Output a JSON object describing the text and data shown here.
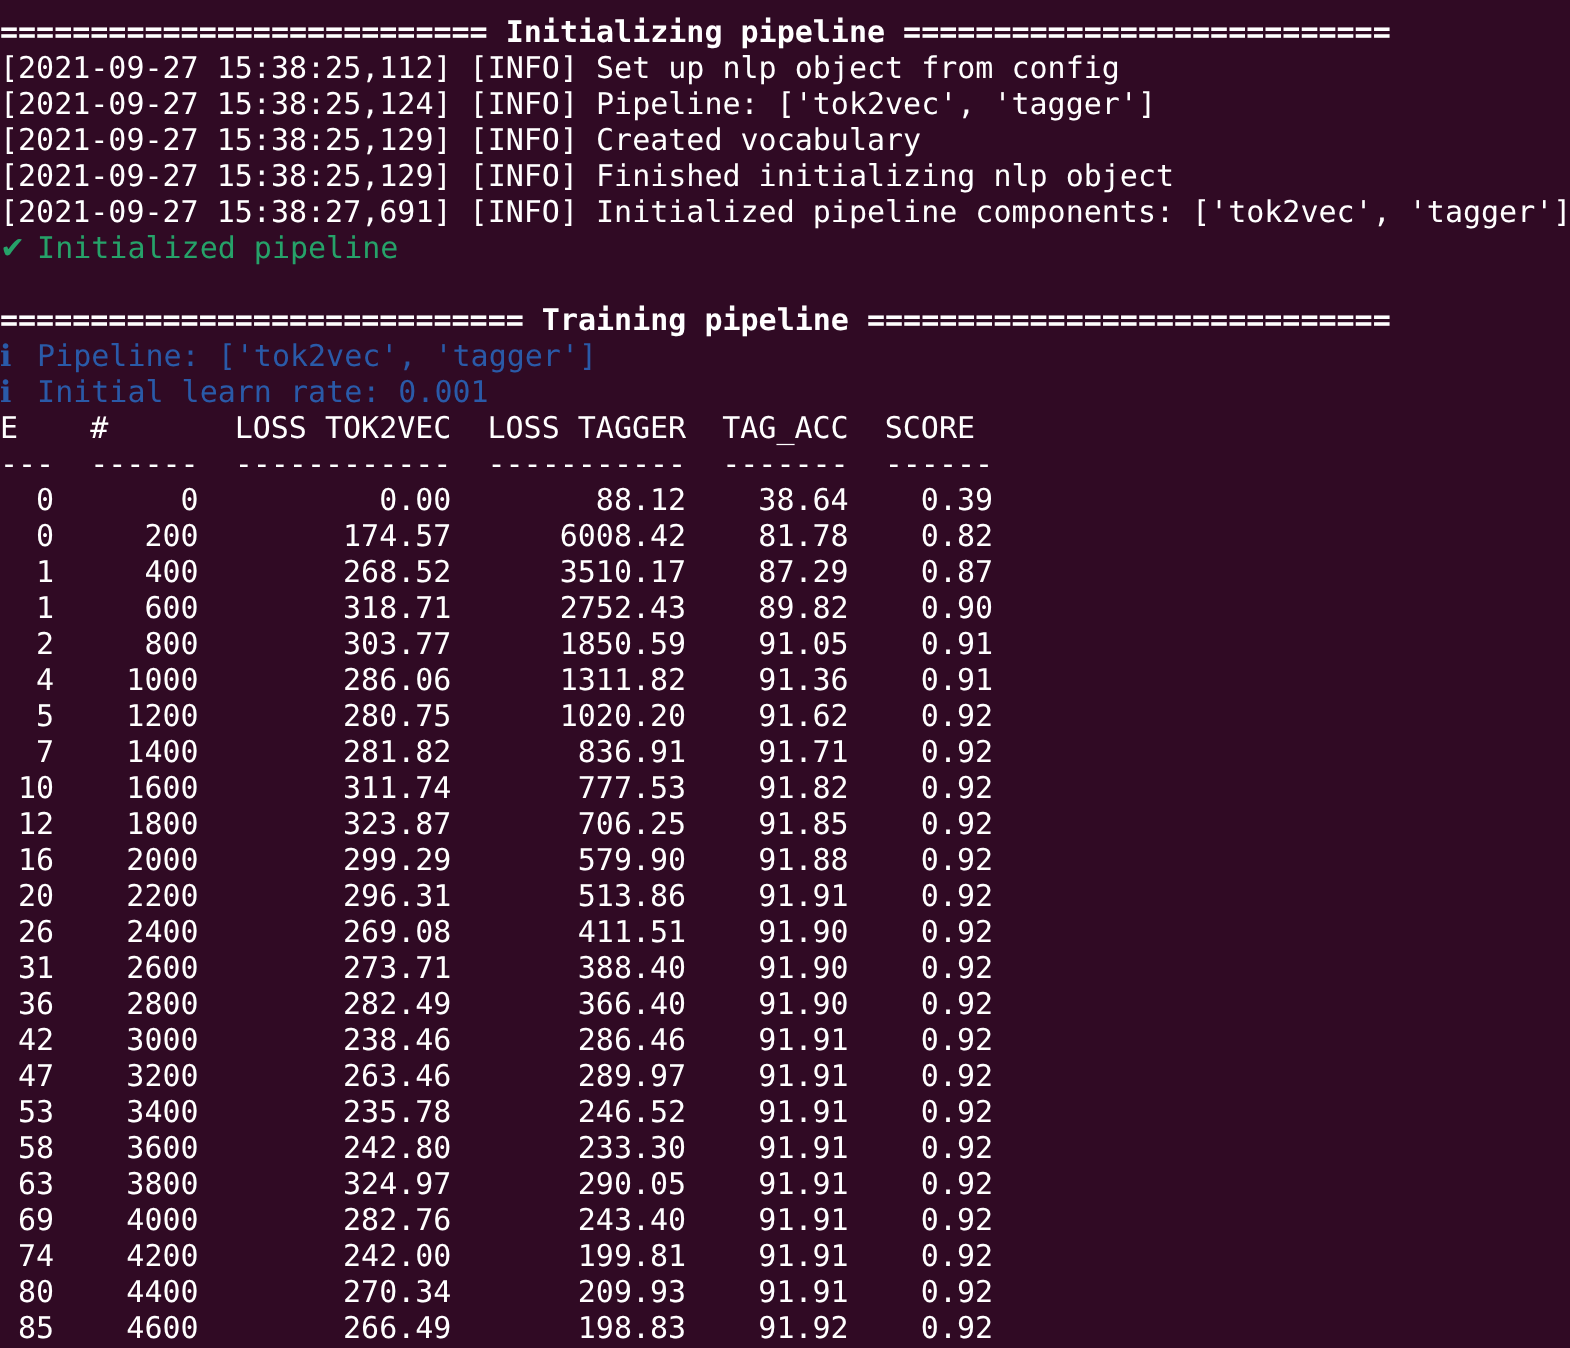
{
  "sections": [
    {
      "title": "=========================== Initializing pipeline ===========================",
      "lines": [
        {
          "kind": "log",
          "text": "[2021-09-27 15:38:25,112] [INFO] Set up nlp object from config"
        },
        {
          "kind": "log",
          "text": "[2021-09-27 15:38:25,124] [INFO] Pipeline: ['tok2vec', 'tagger']"
        },
        {
          "kind": "log",
          "text": "[2021-09-27 15:38:25,129] [INFO] Created vocabulary"
        },
        {
          "kind": "log",
          "text": "[2021-09-27 15:38:25,129] [INFO] Finished initializing nlp object"
        },
        {
          "kind": "log",
          "text": "[2021-09-27 15:38:27,691] [INFO] Initialized pipeline components: ['tok2vec', 'tagger']"
        },
        {
          "kind": "success",
          "icon": "✔",
          "text": "Initialized pipeline"
        }
      ]
    },
    {
      "title": "============================= Training pipeline =============================",
      "lines": [
        {
          "kind": "info",
          "icon": "ℹ",
          "text": "Pipeline: ['tok2vec', 'tagger']"
        },
        {
          "kind": "info",
          "icon": "ℹ",
          "text": "Initial learn rate: 0.001"
        }
      ],
      "table": {
        "columns": [
          "E",
          "#",
          "LOSS TOK2VEC",
          "LOSS TAGGER",
          "TAG_ACC",
          "SCORE"
        ],
        "separator": [
          "---",
          "------",
          "------------",
          "-----------",
          "-------",
          "------"
        ],
        "rows": [
          [
            "0",
            "0",
            "0.00",
            "88.12",
            "38.64",
            "0.39"
          ],
          [
            "0",
            "200",
            "174.57",
            "6008.42",
            "81.78",
            "0.82"
          ],
          [
            "1",
            "400",
            "268.52",
            "3510.17",
            "87.29",
            "0.87"
          ],
          [
            "1",
            "600",
            "318.71",
            "2752.43",
            "89.82",
            "0.90"
          ],
          [
            "2",
            "800",
            "303.77",
            "1850.59",
            "91.05",
            "0.91"
          ],
          [
            "4",
            "1000",
            "286.06",
            "1311.82",
            "91.36",
            "0.91"
          ],
          [
            "5",
            "1200",
            "280.75",
            "1020.20",
            "91.62",
            "0.92"
          ],
          [
            "7",
            "1400",
            "281.82",
            "836.91",
            "91.71",
            "0.92"
          ],
          [
            "10",
            "1600",
            "311.74",
            "777.53",
            "91.82",
            "0.92"
          ],
          [
            "12",
            "1800",
            "323.87",
            "706.25",
            "91.85",
            "0.92"
          ],
          [
            "16",
            "2000",
            "299.29",
            "579.90",
            "91.88",
            "0.92"
          ],
          [
            "20",
            "2200",
            "296.31",
            "513.86",
            "91.91",
            "0.92"
          ],
          [
            "26",
            "2400",
            "269.08",
            "411.51",
            "91.90",
            "0.92"
          ],
          [
            "31",
            "2600",
            "273.71",
            "388.40",
            "91.90",
            "0.92"
          ],
          [
            "36",
            "2800",
            "282.49",
            "366.40",
            "91.90",
            "0.92"
          ],
          [
            "42",
            "3000",
            "238.46",
            "286.46",
            "91.91",
            "0.92"
          ],
          [
            "47",
            "3200",
            "263.46",
            "289.97",
            "91.91",
            "0.92"
          ],
          [
            "53",
            "3400",
            "235.78",
            "246.52",
            "91.91",
            "0.92"
          ],
          [
            "58",
            "3600",
            "242.80",
            "233.30",
            "91.91",
            "0.92"
          ],
          [
            "63",
            "3800",
            "324.97",
            "290.05",
            "91.91",
            "0.92"
          ],
          [
            "69",
            "4000",
            "282.76",
            "243.40",
            "91.91",
            "0.92"
          ],
          [
            "74",
            "4200",
            "242.00",
            "199.81",
            "91.91",
            "0.92"
          ],
          [
            "80",
            "4400",
            "270.34",
            "209.93",
            "91.91",
            "0.92"
          ],
          [
            "85",
            "4600",
            "266.49",
            "198.83",
            "91.92",
            "0.92"
          ]
        ]
      }
    }
  ]
}
